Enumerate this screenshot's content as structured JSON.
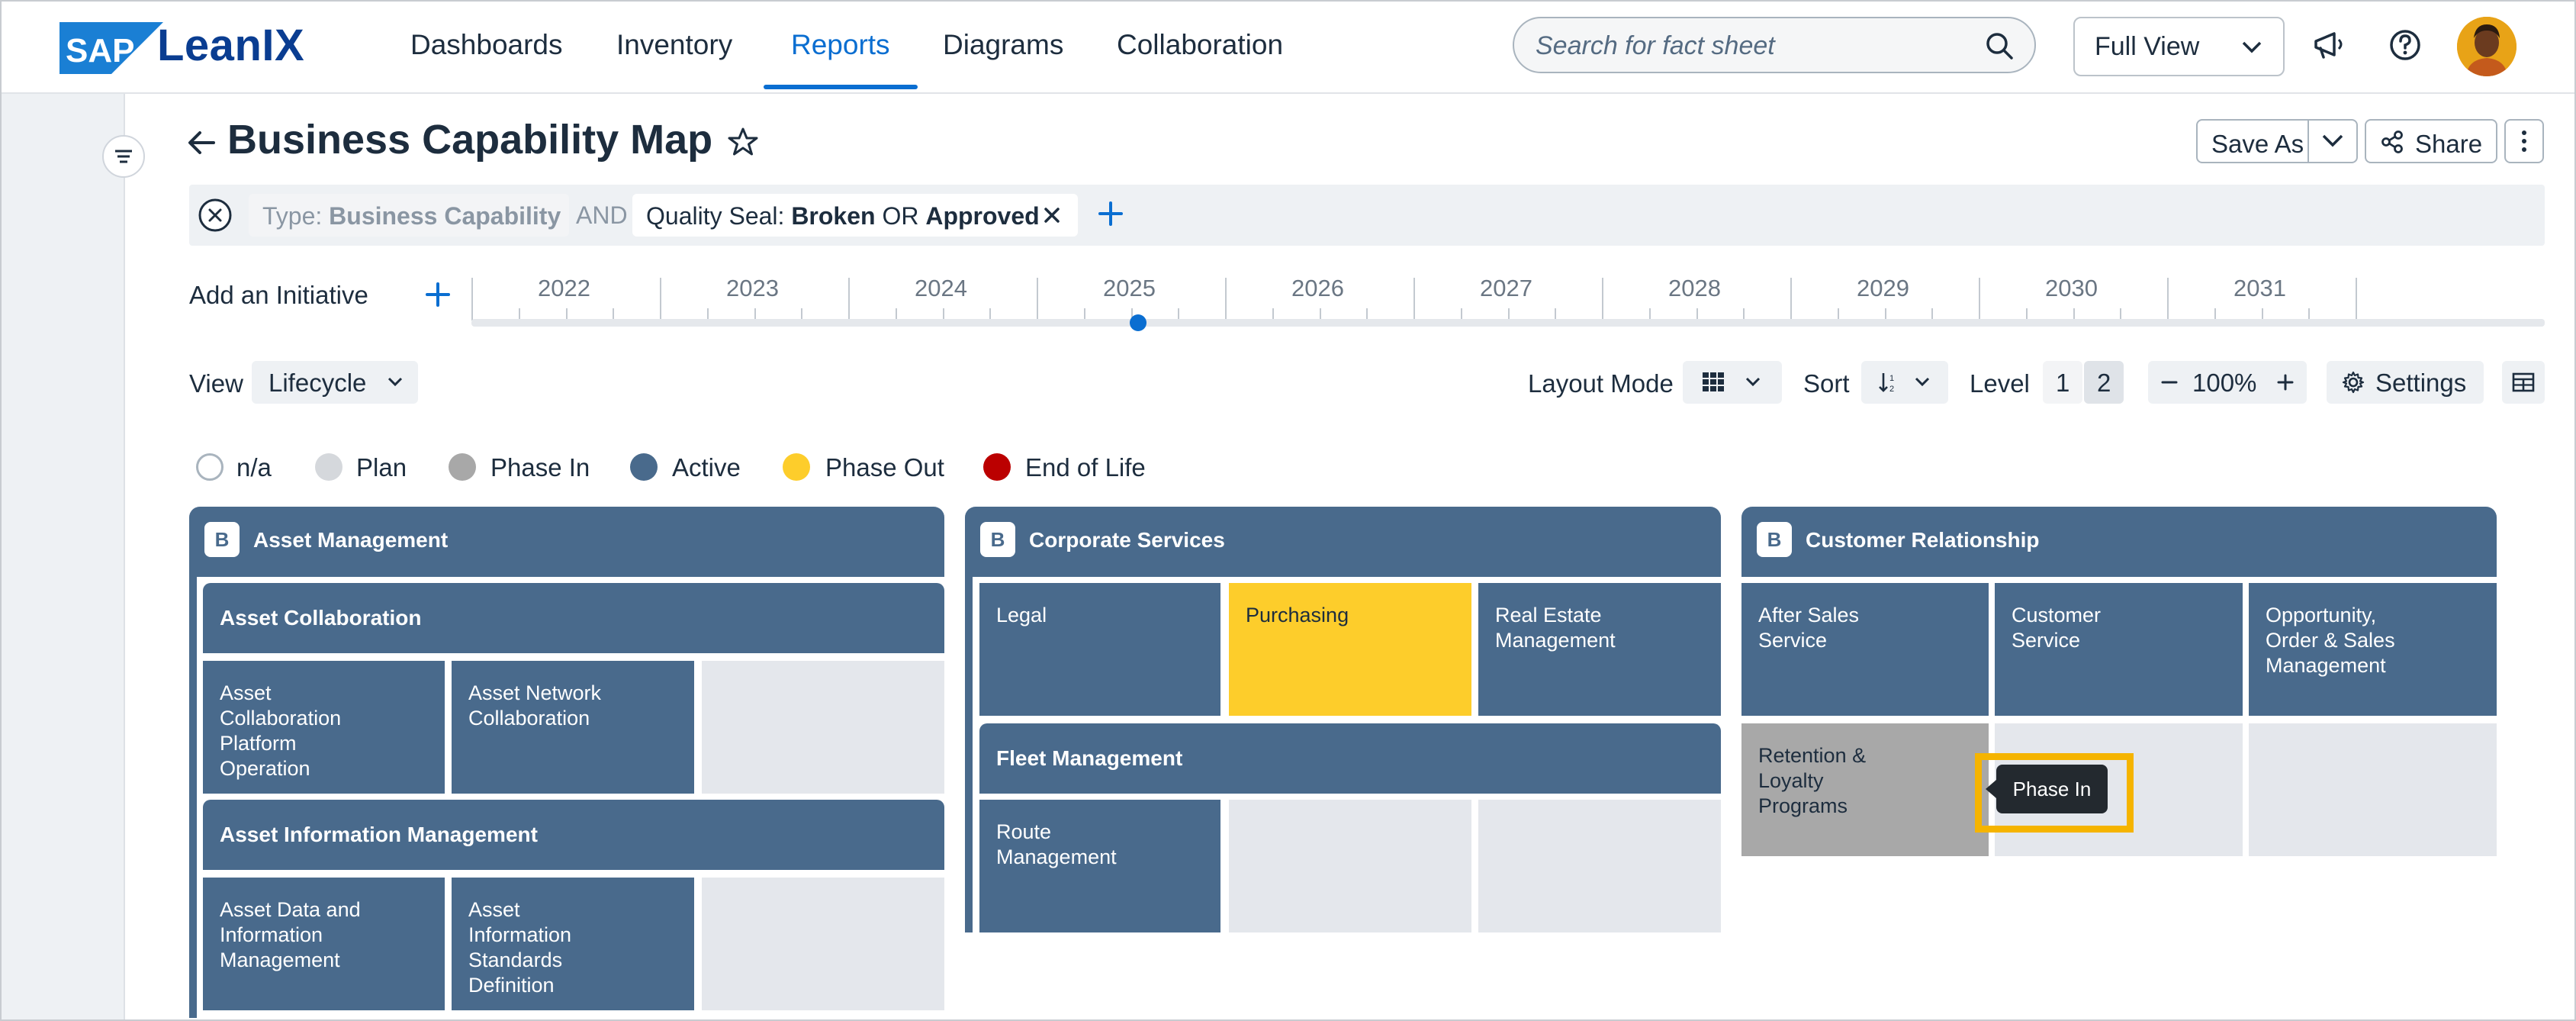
{
  "brand": {
    "logo_mark": "SAP",
    "logo_text": "LeanIX"
  },
  "nav": {
    "items": [
      {
        "label": "Dashboards"
      },
      {
        "label": "Inventory"
      },
      {
        "label": "Reports"
      },
      {
        "label": "Diagrams"
      },
      {
        "label": "Collaboration"
      }
    ],
    "active": "Reports"
  },
  "search": {
    "placeholder": "Search for fact sheet"
  },
  "view_selector": {
    "label": "Full View"
  },
  "header": {
    "title": "Business Capability Map",
    "save_as": "Save As",
    "share": "Share"
  },
  "filters": {
    "type_prefix": "Type: ",
    "type_value": "Business Capability",
    "and": "AND",
    "seal_prefix": "Quality Seal: ",
    "seal_value1": "Broken",
    "seal_or": " OR ",
    "seal_value2": "Approved"
  },
  "timeline": {
    "add_label": "Add an Initiative",
    "years": [
      "2022",
      "2023",
      "2024",
      "2025",
      "2026",
      "2027",
      "2028",
      "2029",
      "2030",
      "2031"
    ],
    "selected_year": "2025"
  },
  "toolbar": {
    "view_label": "View",
    "view_value": "Lifecycle",
    "layout_mode_label": "Layout Mode",
    "sort_label": "Sort",
    "level_label": "Level",
    "level_1": "1",
    "level_2": "2",
    "zoom": "100%",
    "settings": "Settings"
  },
  "legend": [
    {
      "label": "n/a",
      "color": "#ffffff"
    },
    {
      "label": "Plan",
      "color": "#d5d8dc"
    },
    {
      "label": "Phase In",
      "color": "#a8a8a8"
    },
    {
      "label": "Active",
      "color": "#496a8c"
    },
    {
      "label": "Phase Out",
      "color": "#fdcd2b"
    },
    {
      "label": "End of Life",
      "color": "#bb0000"
    }
  ],
  "map": {
    "badge": "B",
    "asset_management": {
      "title": "Asset Management",
      "asset_collaboration": {
        "title": "Asset Collaboration",
        "children": [
          "Asset\nCollaboration\nPlatform\nOperation",
          "Asset Network\nCollaboration"
        ]
      },
      "asset_information": {
        "title": "Asset Information Management",
        "children": [
          "Asset Data and\nInformation\nManagement",
          "Asset\nInformation\nStandards\nDefinition"
        ]
      }
    },
    "corporate_services": {
      "title": "Corporate Services",
      "children": [
        "Legal",
        "Purchasing",
        "Real Estate\nManagement"
      ],
      "fleet": {
        "title": "Fleet Management",
        "children": [
          "Route\nManagement"
        ]
      }
    },
    "customer_relationship": {
      "title": "Customer Relationship",
      "children": [
        "After Sales\nService",
        "Customer\nService",
        "Opportunity,\nOrder & Sales\nManagement",
        "Retention &\nLoyalty\nPrograms"
      ]
    }
  },
  "tooltip": {
    "text": "Phase In"
  },
  "colors": {
    "accent": "#0a6ed1",
    "active": "#496a8c",
    "phase_out": "#fdcd2b",
    "phase_in": "#a8a8a8",
    "highlight": "#f5b400"
  }
}
